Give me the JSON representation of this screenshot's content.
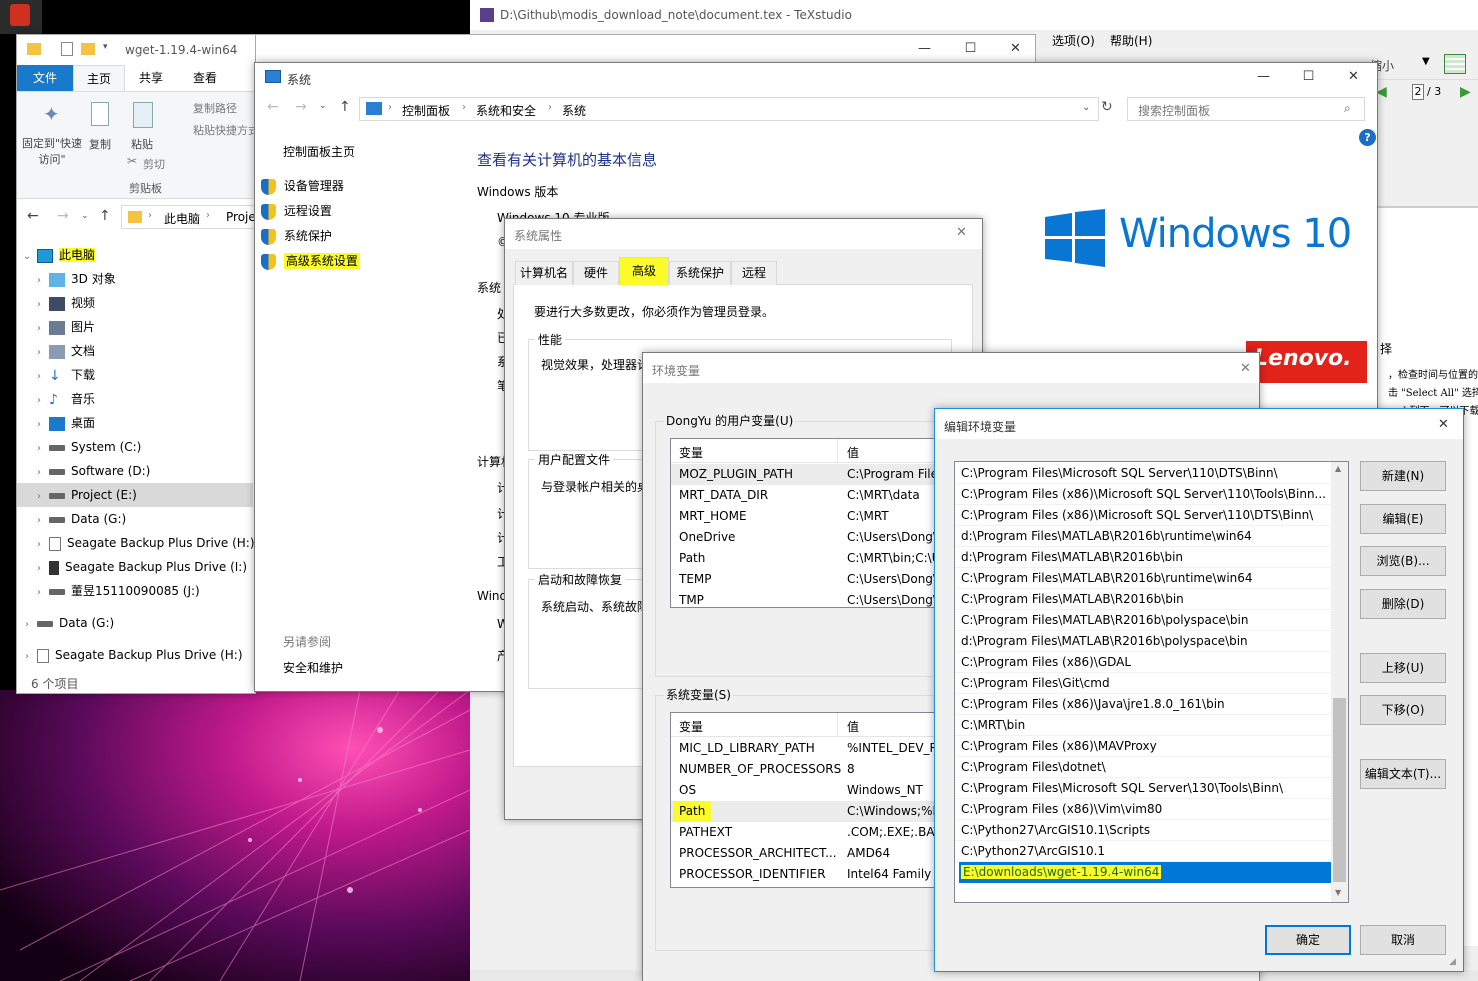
{
  "texstudio": {
    "title": "D:\\Github\\modis_download_note\\document.tex - TeXstudio",
    "menu_options": "选项(O)",
    "menu_help": "帮助(H)",
    "zoom_hint": "缩小",
    "page_value": "2",
    "page_total": "/ 3",
    "right_text_1": "择",
    "right_text_2": "，检查时间与位置的",
    "right_text_3": "击 \"Select All\" 选择",
    "right_text_4": "oad 列下，可以下载",
    "bottom_ok": "确定",
    "bottom_cancel": "取消"
  },
  "explorer": {
    "title": "wget-1.19.4-win64",
    "tabs": [
      "文件",
      "主页",
      "共享",
      "查看"
    ],
    "ribbon": {
      "pin": "固定到\"快速访问\"",
      "copy": "复制",
      "paste": "粘贴",
      "copy_path": "复制路径",
      "paste_shortcut": "粘贴快捷方式",
      "cut": "剪切",
      "group": "剪贴板"
    },
    "address": {
      "this_pc": "此电脑",
      "project": "Proje"
    },
    "tree": [
      {
        "label": "此电脑",
        "icon": "pc-icon",
        "highlight": true
      },
      {
        "label": "3D 对象",
        "icon": "cube-icon"
      },
      {
        "label": "视频",
        "icon": "video-icon"
      },
      {
        "label": "图片",
        "icon": "picture-icon"
      },
      {
        "label": "文档",
        "icon": "document-icon"
      },
      {
        "label": "下载",
        "icon": "download-icon"
      },
      {
        "label": "音乐",
        "icon": "music-icon"
      },
      {
        "label": "桌面",
        "icon": "desktop-icon"
      },
      {
        "label": "System (C:)",
        "icon": "drive-icon"
      },
      {
        "label": "Software (D:)",
        "icon": "drive-icon"
      },
      {
        "label": "Project (E:)",
        "icon": "drive-icon",
        "selected": true
      },
      {
        "label": "Data (G:)",
        "icon": "drive-icon"
      },
      {
        "label": "Seagate Backup Plus Drive (H:)",
        "icon": "file-icon"
      },
      {
        "label": "Seagate Backup Plus Drive (I:)",
        "icon": "phone-icon"
      },
      {
        "label": "董昱15110090085 (J:)",
        "icon": "drive-icon"
      }
    ],
    "tree_extra": [
      {
        "label": "Data (G:)",
        "icon": "drive-icon"
      },
      {
        "label": "Seagate Backup Plus Drive (H:)",
        "icon": "file-icon"
      }
    ],
    "status": "6 个项目"
  },
  "system": {
    "title": "系统",
    "breadcrumb": [
      "控制面板",
      "系统和安全",
      "系统"
    ],
    "search_placeholder": "搜索控制面板",
    "left": {
      "home": "控制面板主页",
      "links": [
        "设备管理器",
        "远程设置",
        "系统保护",
        "高级系统设置"
      ],
      "see_also": "另请参阅",
      "security": "安全和维护"
    },
    "heading": "查看有关计算机的基本信息",
    "windows_edition": "Windows 版本",
    "edition_value": "Windows 10 专业版",
    "copyright_prefix": "©",
    "section_system": "系统",
    "section_computer": "计算机",
    "section_activation": "Wind",
    "logo_text": "Windows 10",
    "lenovo": "Lenovo.",
    "stubs": [
      "处",
      "已",
      "系",
      "笔"
    ],
    "stubs2": [
      "计",
      "计",
      "计",
      "工"
    ],
    "stubs3": [
      "W",
      "产"
    ]
  },
  "sysprops": {
    "title": "系统属性",
    "tabs": [
      "计算机名",
      "硬件",
      "高级",
      "系统保护",
      "远程"
    ],
    "admin_note": "要进行大多数更改，你必须作为管理员登录。",
    "perf_title": "性能",
    "perf_text": "视觉效果，处理器计",
    "profile_title": "用户配置文件",
    "profile_text": "与登录帐户相关的桌",
    "startup_title": "启动和故障恢复",
    "startup_text": "系统启动、系统故障"
  },
  "envvars": {
    "title": "环境变量",
    "user_group": "DongYu 的用户变量(U)",
    "col_var": "变量",
    "col_val": "值",
    "user_vars": [
      {
        "name": "MOZ_PLUGIN_PATH",
        "value": "C:\\Program File"
      },
      {
        "name": "MRT_DATA_DIR",
        "value": "C:\\MRT\\data"
      },
      {
        "name": "MRT_HOME",
        "value": "C:\\MRT"
      },
      {
        "name": "OneDrive",
        "value": "C:\\Users\\Dong\\"
      },
      {
        "name": "Path",
        "value": "C:\\MRT\\bin;C:\\U"
      },
      {
        "name": "TEMP",
        "value": "C:\\Users\\Dong\\"
      },
      {
        "name": "TMP",
        "value": "C:\\Users\\Dong\\"
      }
    ],
    "sys_group": "系统变量(S)",
    "sys_vars": [
      {
        "name": "MIC_LD_LIBRARY_PATH",
        "value": "%INTEL_DEV_RE"
      },
      {
        "name": "NUMBER_OF_PROCESSORS",
        "value": "8"
      },
      {
        "name": "OS",
        "value": "Windows_NT"
      },
      {
        "name": "Path",
        "value": "C:\\Windows;%IN",
        "highlight": true
      },
      {
        "name": "PATHEXT",
        "value": ".COM;.EXE;.BAT"
      },
      {
        "name": "PROCESSOR_ARCHITECT...",
        "value": "AMD64"
      },
      {
        "name": "PROCESSOR_IDENTIFIER",
        "value": "Intel64 Family"
      }
    ]
  },
  "editenv": {
    "title": "编辑环境变量",
    "paths": [
      "C:\\Program Files\\Microsoft SQL Server\\110\\DTS\\Binn\\",
      "C:\\Program Files (x86)\\Microsoft SQL Server\\110\\Tools\\Binn...",
      "C:\\Program Files (x86)\\Microsoft SQL Server\\110\\DTS\\Binn\\",
      "d:\\Program Files\\MATLAB\\R2016b\\runtime\\win64",
      "d:\\Program Files\\MATLAB\\R2016b\\bin",
      "C:\\Program Files\\MATLAB\\R2016b\\runtime\\win64",
      "C:\\Program Files\\MATLAB\\R2016b\\bin",
      "C:\\Program Files\\MATLAB\\R2016b\\polyspace\\bin",
      "d:\\Program Files\\MATLAB\\R2016b\\polyspace\\bin",
      "C:\\Program Files (x86)\\GDAL",
      "C:\\Program Files\\Git\\cmd",
      "C:\\Program Files (x86)\\Java\\jre1.8.0_161\\bin",
      "C:\\MRT\\bin",
      "C:\\Program Files (x86)\\MAVProxy",
      "C:\\Program Files\\dotnet\\",
      "C:\\Program Files\\Microsoft SQL Server\\130\\Tools\\Binn\\",
      "C:\\Program Files (x86)\\Vim\\vim80",
      "C:\\Python27\\ArcGIS10.1\\Scripts",
      "C:\\Python27\\ArcGIS10.1",
      "E:\\downloads\\wget-1.19.4-win64"
    ],
    "buttons": {
      "new": "新建(N)",
      "edit": "编辑(E)",
      "browse": "浏览(B)...",
      "delete": "删除(D)",
      "up": "上移(U)",
      "down": "下移(O)",
      "edit_text": "编辑文本(T)..."
    },
    "ok": "确定",
    "cancel": "取消"
  },
  "colors": {
    "accent": "#0078d7",
    "highlight": "#fbfb2c",
    "win_blue": "#0a76d4",
    "lenovo_red": "#e2231a"
  }
}
